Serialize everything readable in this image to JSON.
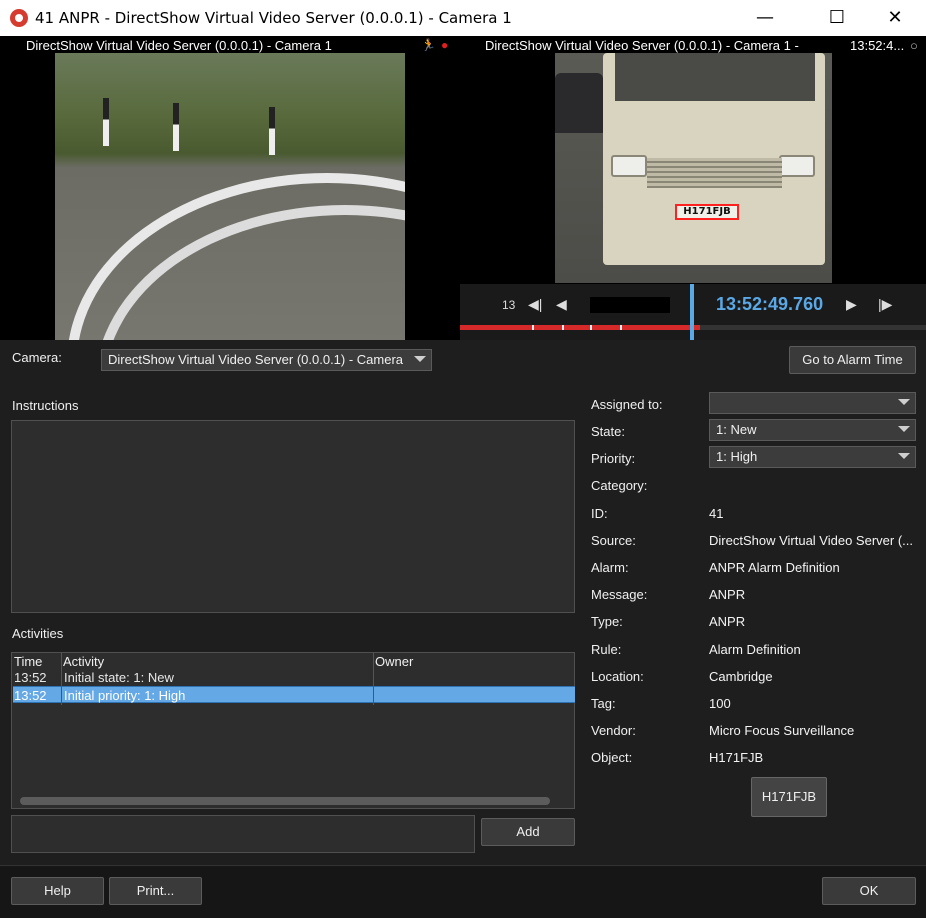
{
  "window": {
    "title": "41 ANPR - DirectShow Virtual Video Server (0.0.0.1) - Camera 1",
    "minimize": "—",
    "maximize": "☐",
    "close": "✕"
  },
  "video_left": {
    "title": "DirectShow Virtual Video Server (0.0.0.1) - Camera 1"
  },
  "video_right": {
    "title": "DirectShow Virtual Video Server (0.0.0.1) - Camera 1 -",
    "time_short": "13:52:4...",
    "plate_overlay": "H171FJB",
    "playback_left_label": "13",
    "playback_time": "13:52:49.760"
  },
  "camera": {
    "label": "Camera:",
    "selected": "DirectShow Virtual Video Server (0.0.0.1) - Camera",
    "goto_button": "Go to Alarm Time"
  },
  "instructions": {
    "label": "Instructions"
  },
  "activities": {
    "label": "Activities",
    "columns": [
      "Time",
      "Activity",
      "Owner"
    ],
    "rows": [
      {
        "time": "13:52",
        "activity": "Initial state: 1: New",
        "owner": ""
      },
      {
        "time": "13:52",
        "activity": "Initial priority: 1: High",
        "owner": ""
      }
    ],
    "add_button": "Add"
  },
  "details": {
    "assigned_to": {
      "label": "Assigned to:",
      "value": ""
    },
    "state": {
      "label": "State:",
      "value": "1: New"
    },
    "priority": {
      "label": "Priority:",
      "value": "1: High"
    },
    "category": {
      "label": "Category:",
      "value": ""
    },
    "id": {
      "label": "ID:",
      "value": "41"
    },
    "source": {
      "label": "Source:",
      "value": "DirectShow Virtual Video Server (..."
    },
    "alarm": {
      "label": "Alarm:",
      "value": "ANPR Alarm Definition"
    },
    "message": {
      "label": "Message:",
      "value": "ANPR"
    },
    "type": {
      "label": "Type:",
      "value": "ANPR"
    },
    "rule": {
      "label": "Rule:",
      "value": "Alarm Definition"
    },
    "location": {
      "label": "Location:",
      "value": "Cambridge"
    },
    "tag": {
      "label": "Tag:",
      "value": "100"
    },
    "vendor": {
      "label": "Vendor:",
      "value": "Micro Focus Surveillance"
    },
    "object": {
      "label": "Object:",
      "value": "H171FJB"
    },
    "plate_button": "H171FJB"
  },
  "footer": {
    "help": "Help",
    "print": "Print...",
    "ok": "OK"
  }
}
